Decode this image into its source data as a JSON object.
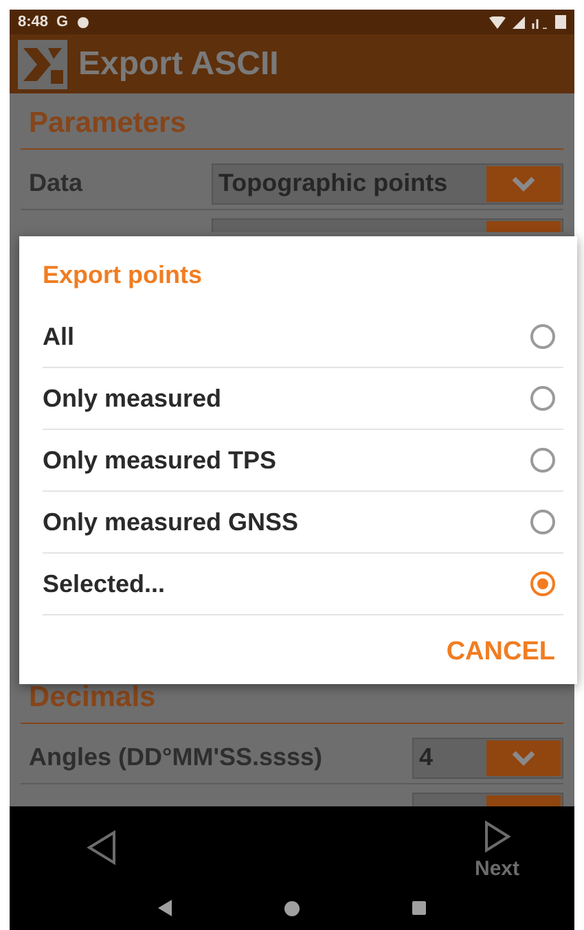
{
  "status_bar": {
    "time": "8:48",
    "carrier": "G"
  },
  "app_bar": {
    "title": "Export ASCII"
  },
  "sections": [
    {
      "title": "Parameters",
      "rows": [
        {
          "label": "Data",
          "value": "Topographic points"
        }
      ]
    },
    {
      "title": "Decimals",
      "rows": [
        {
          "label": "Angles (DD°MM'SS.ssss)",
          "value": "4"
        }
      ]
    }
  ],
  "dialog": {
    "title": "Export points",
    "options": [
      {
        "label": "All",
        "selected": false
      },
      {
        "label": "Only measured",
        "selected": false
      },
      {
        "label": "Only measured TPS",
        "selected": false
      },
      {
        "label": "Only measured GNSS",
        "selected": false
      },
      {
        "label": "Selected...",
        "selected": true
      }
    ],
    "button": "CANCEL"
  },
  "bottom_bar": {
    "next": "Next"
  }
}
